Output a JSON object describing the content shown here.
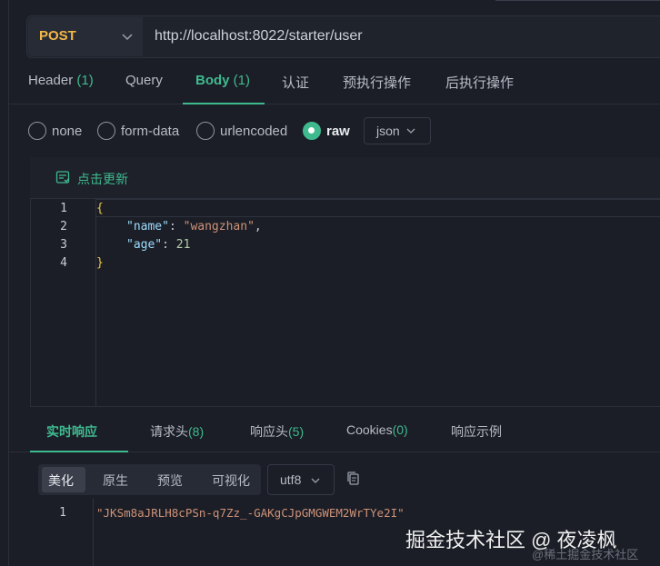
{
  "request": {
    "method": "POST",
    "url": "http://localhost:8022/starter/user"
  },
  "tabs": [
    {
      "label": "Header",
      "count": "(1)"
    },
    {
      "label": "Query",
      "count": ""
    },
    {
      "label": "Body",
      "count": "(1)"
    },
    {
      "label": "认证",
      "count": ""
    },
    {
      "label": "预执行操作",
      "count": ""
    },
    {
      "label": "后执行操作",
      "count": ""
    }
  ],
  "active_tab": "Body",
  "body_types": [
    "none",
    "form-data",
    "urlencoded",
    "raw"
  ],
  "selected_body_type": "raw",
  "format_select": "json",
  "editor": {
    "refresh_label": "点击更新",
    "lines": [
      {
        "n": "1",
        "open": "{"
      },
      {
        "n": "2",
        "key": "\"name\"",
        "sep": ": ",
        "value": "\"wangzhan\"",
        "trail": ","
      },
      {
        "n": "3",
        "key": "\"age\"",
        "sep": ": ",
        "value": "21",
        "trail": ""
      },
      {
        "n": "4",
        "close": "}"
      }
    ]
  },
  "response": {
    "tabs": [
      {
        "label": "实时响应",
        "count": ""
      },
      {
        "label": "请求头",
        "count": "(8)"
      },
      {
        "label": "响应头",
        "count": "(5)"
      },
      {
        "label": "Cookies",
        "count": "(0)"
      },
      {
        "label": "响应示例",
        "count": ""
      }
    ],
    "active_tab": "实时响应",
    "format_options": [
      "美化",
      "原生",
      "预览",
      "可视化"
    ],
    "active_format": "美化",
    "encoding": "utf8",
    "line_no": "1",
    "body": "\"JKSm8aJRLH8cPSn-q7Zz_-GAKgCJpGMGWEM2WrTYe2I\""
  },
  "watermark": {
    "main": "掘金技术社区 @ 夜凌枫",
    "sub": "@稀土掘金技术社区"
  },
  "colors": {
    "accent": "#3fba8f",
    "method": "#f4b646",
    "background": "#1b1e26"
  }
}
